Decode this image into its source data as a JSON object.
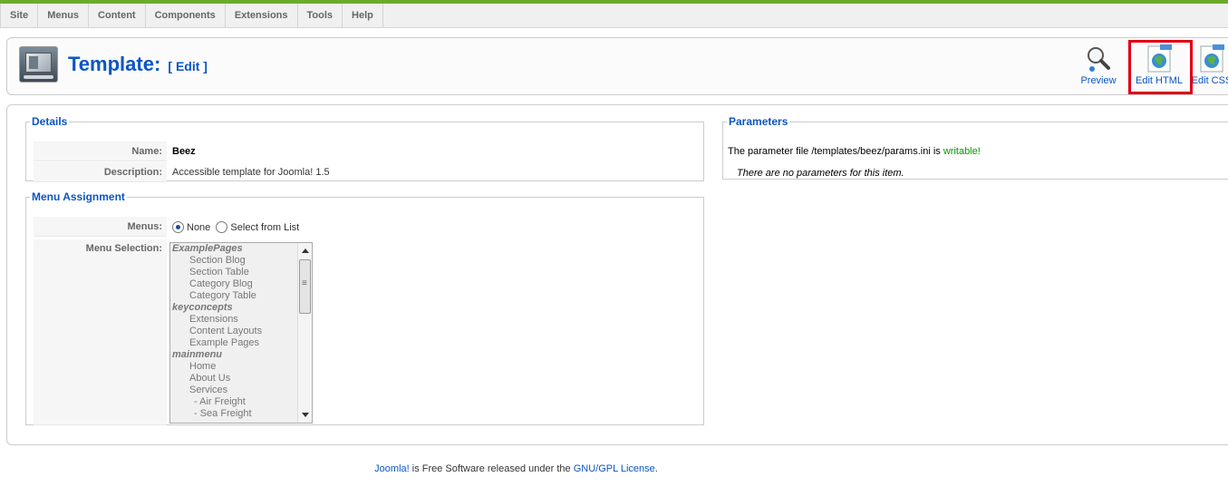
{
  "menu": {
    "items": [
      "Site",
      "Menus",
      "Content",
      "Components",
      "Extensions",
      "Tools",
      "Help"
    ]
  },
  "header": {
    "title": "Template:",
    "subtitle": "[ Edit ]"
  },
  "toolbar": {
    "preview_label": "Preview",
    "edit_html_label": "Edit HTML",
    "edit_css_label": "Edit CSS"
  },
  "details": {
    "legend": "Details",
    "name_label": "Name:",
    "name_value": "Beez",
    "description_label": "Description:",
    "description_value": "Accessible template for Joomla! 1.5"
  },
  "menu_assignment": {
    "legend": "Menu Assignment",
    "menus_label": "Menus:",
    "option_none": "None",
    "option_select": "Select from List",
    "selected": "None",
    "selection_label": "Menu Selection:",
    "list": [
      {
        "text": "ExamplePages",
        "type": "group"
      },
      {
        "text": "Section Blog",
        "type": "item"
      },
      {
        "text": "Section Table",
        "type": "item"
      },
      {
        "text": "Category Blog",
        "type": "item"
      },
      {
        "text": "Category Table",
        "type": "item"
      },
      {
        "text": "keyconcepts",
        "type": "group"
      },
      {
        "text": "Extensions",
        "type": "item"
      },
      {
        "text": "Content Layouts",
        "type": "item"
      },
      {
        "text": "Example Pages",
        "type": "item"
      },
      {
        "text": "mainmenu",
        "type": "group"
      },
      {
        "text": "Home",
        "type": "item"
      },
      {
        "text": "About Us",
        "type": "item"
      },
      {
        "text": "Services",
        "type": "item"
      },
      {
        "text": "- Air Freight",
        "type": "subitem"
      },
      {
        "text": "- Sea Freight",
        "type": "subitem"
      }
    ]
  },
  "parameters": {
    "legend": "Parameters",
    "file_text": "The parameter file /templates/beez/params.ini is",
    "status": "writable!",
    "none_text": "There are no parameters for this item."
  },
  "footer": {
    "link1": "Joomla!",
    "text": " is Free Software released under the ",
    "link2": "GNU/GPL License",
    "end": "."
  },
  "colors": {
    "accent": "#0b55c4",
    "topbar": "#6bab2c",
    "highlight": "#e00012",
    "writable": "#009900"
  }
}
